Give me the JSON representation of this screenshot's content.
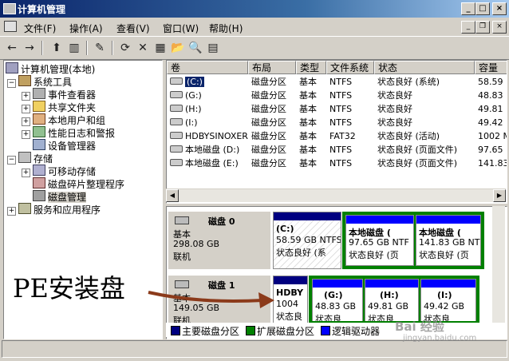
{
  "window": {
    "title": "计算机管理",
    "minimize": "_",
    "maximize": "□",
    "close": "×"
  },
  "menu": {
    "items": [
      "文件(F)",
      "操作(A)",
      "查看(V)",
      "窗口(W)",
      "帮助(H)"
    ],
    "child_min": "_",
    "child_restore": "❐",
    "child_close": "×"
  },
  "toolbar": {
    "icons": [
      "back-icon",
      "forward-icon",
      "up-icon",
      "show-tree-icon",
      "properties-icon",
      "refresh-icon",
      "delete-icon",
      "help-icon",
      "open-icon",
      "search-icon",
      "details-icon"
    ]
  },
  "tree": {
    "root": "计算机管理(本地)",
    "system_tools": "系统工具",
    "event_viewer": "事件查看器",
    "shared_folders": "共享文件夹",
    "local_users": "本地用户和组",
    "perf_logs": "性能日志和警报",
    "device_manager": "设备管理器",
    "storage": "存储",
    "removable": "可移动存储",
    "defrag": "磁盘碎片整理程序",
    "disk_mgmt": "磁盘管理",
    "services": "服务和应用程序"
  },
  "volumes": {
    "columns": [
      "卷",
      "布局",
      "类型",
      "文件系统",
      "状态",
      "容量"
    ],
    "rows": [
      [
        "(C:)",
        "磁盘分区",
        "基本",
        "NTFS",
        "状态良好 (系统)",
        "58.59"
      ],
      [
        "(G:)",
        "磁盘分区",
        "基本",
        "NTFS",
        "状态良好",
        "48.83"
      ],
      [
        "(H:)",
        "磁盘分区",
        "基本",
        "NTFS",
        "状态良好",
        "49.81"
      ],
      [
        "(I:)",
        "磁盘分区",
        "基本",
        "NTFS",
        "状态良好",
        "49.42"
      ],
      [
        "HDBYSINOXER",
        "磁盘分区",
        "基本",
        "FAT32",
        "状态良好 (活动)",
        "1002 M"
      ],
      [
        "本地磁盘 (D:)",
        "磁盘分区",
        "基本",
        "NTFS",
        "状态良好 (页面文件)",
        "97.65"
      ],
      [
        "本地磁盘 (E:)",
        "磁盘分区",
        "基本",
        "NTFS",
        "状态良好 (页面文件)",
        "141.83"
      ]
    ]
  },
  "disks": [
    {
      "name": "磁盘 0",
      "type": "基本",
      "size": "298.08 GB",
      "status": "联机",
      "parts": [
        {
          "label": "(C:)",
          "size": "58.59 GB NTFS",
          "state": "状态良好 (系"
        },
        {
          "label": "本地磁盘 (",
          "size": "97.65 GB NTF",
          "state": "状态良好 (页"
        },
        {
          "label": "本地磁盘 (",
          "size": "141.83 GB NT",
          "state": "状态良好 (页"
        }
      ]
    },
    {
      "name": "磁盘 1",
      "type": "基本",
      "size": "149.05 GB",
      "status": "联机",
      "parts": [
        {
          "label": "HDBY",
          "size": "1004",
          "state": "状态良"
        },
        {
          "label": "(G:)",
          "size": "48.83 GB",
          "state": "状态良"
        },
        {
          "label": "(H:)",
          "size": "49.81 GB",
          "state": "状态良"
        },
        {
          "label": "(I:)",
          "size": "49.42 GB",
          "state": "状态良"
        }
      ]
    }
  ],
  "legend": {
    "primary": "主要磁盘分区",
    "extended": "扩展磁盘分区",
    "logical": "逻辑驱动器"
  },
  "colors": {
    "primary": "#000080",
    "extended": "#008000",
    "logical": "#0000ff",
    "annot_arrow": "#8b3a1a"
  },
  "annotation": {
    "text": "PE安装盘"
  },
  "watermark": {
    "brand": "Bai 经验",
    "url": "jingyan.baidu.com"
  }
}
